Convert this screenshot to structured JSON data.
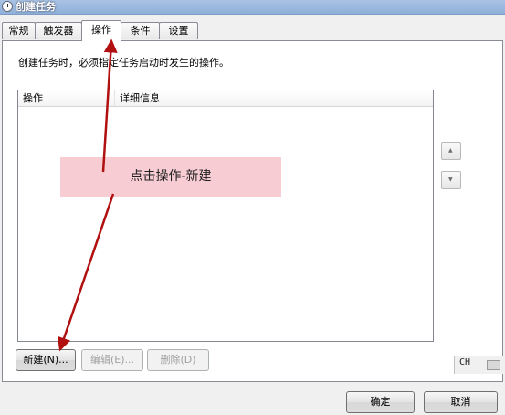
{
  "window": {
    "title": "创建任务"
  },
  "tabs": [
    {
      "label": "常规"
    },
    {
      "label": "触发器"
    },
    {
      "label": "操作",
      "active": true
    },
    {
      "label": "条件"
    },
    {
      "label": "设置"
    }
  ],
  "panel": {
    "description": "创建任务时，必须指定任务启动时发生的操作。",
    "list": {
      "columns": [
        "操作",
        "详细信息"
      ],
      "rows": []
    },
    "move_up_icon": "up-triangle-icon",
    "move_down_icon": "down-triangle-icon",
    "buttons": {
      "new": "新建(N)...",
      "edit": "编辑(E)...",
      "delete": "删除(D)"
    }
  },
  "footer": {
    "ok": "确定",
    "cancel": "取消"
  },
  "ime": {
    "label": "CH"
  },
  "annotation": {
    "text": "点击操作-新建",
    "arrow_color": "#b01010",
    "box_color": "#f7ccd2"
  }
}
